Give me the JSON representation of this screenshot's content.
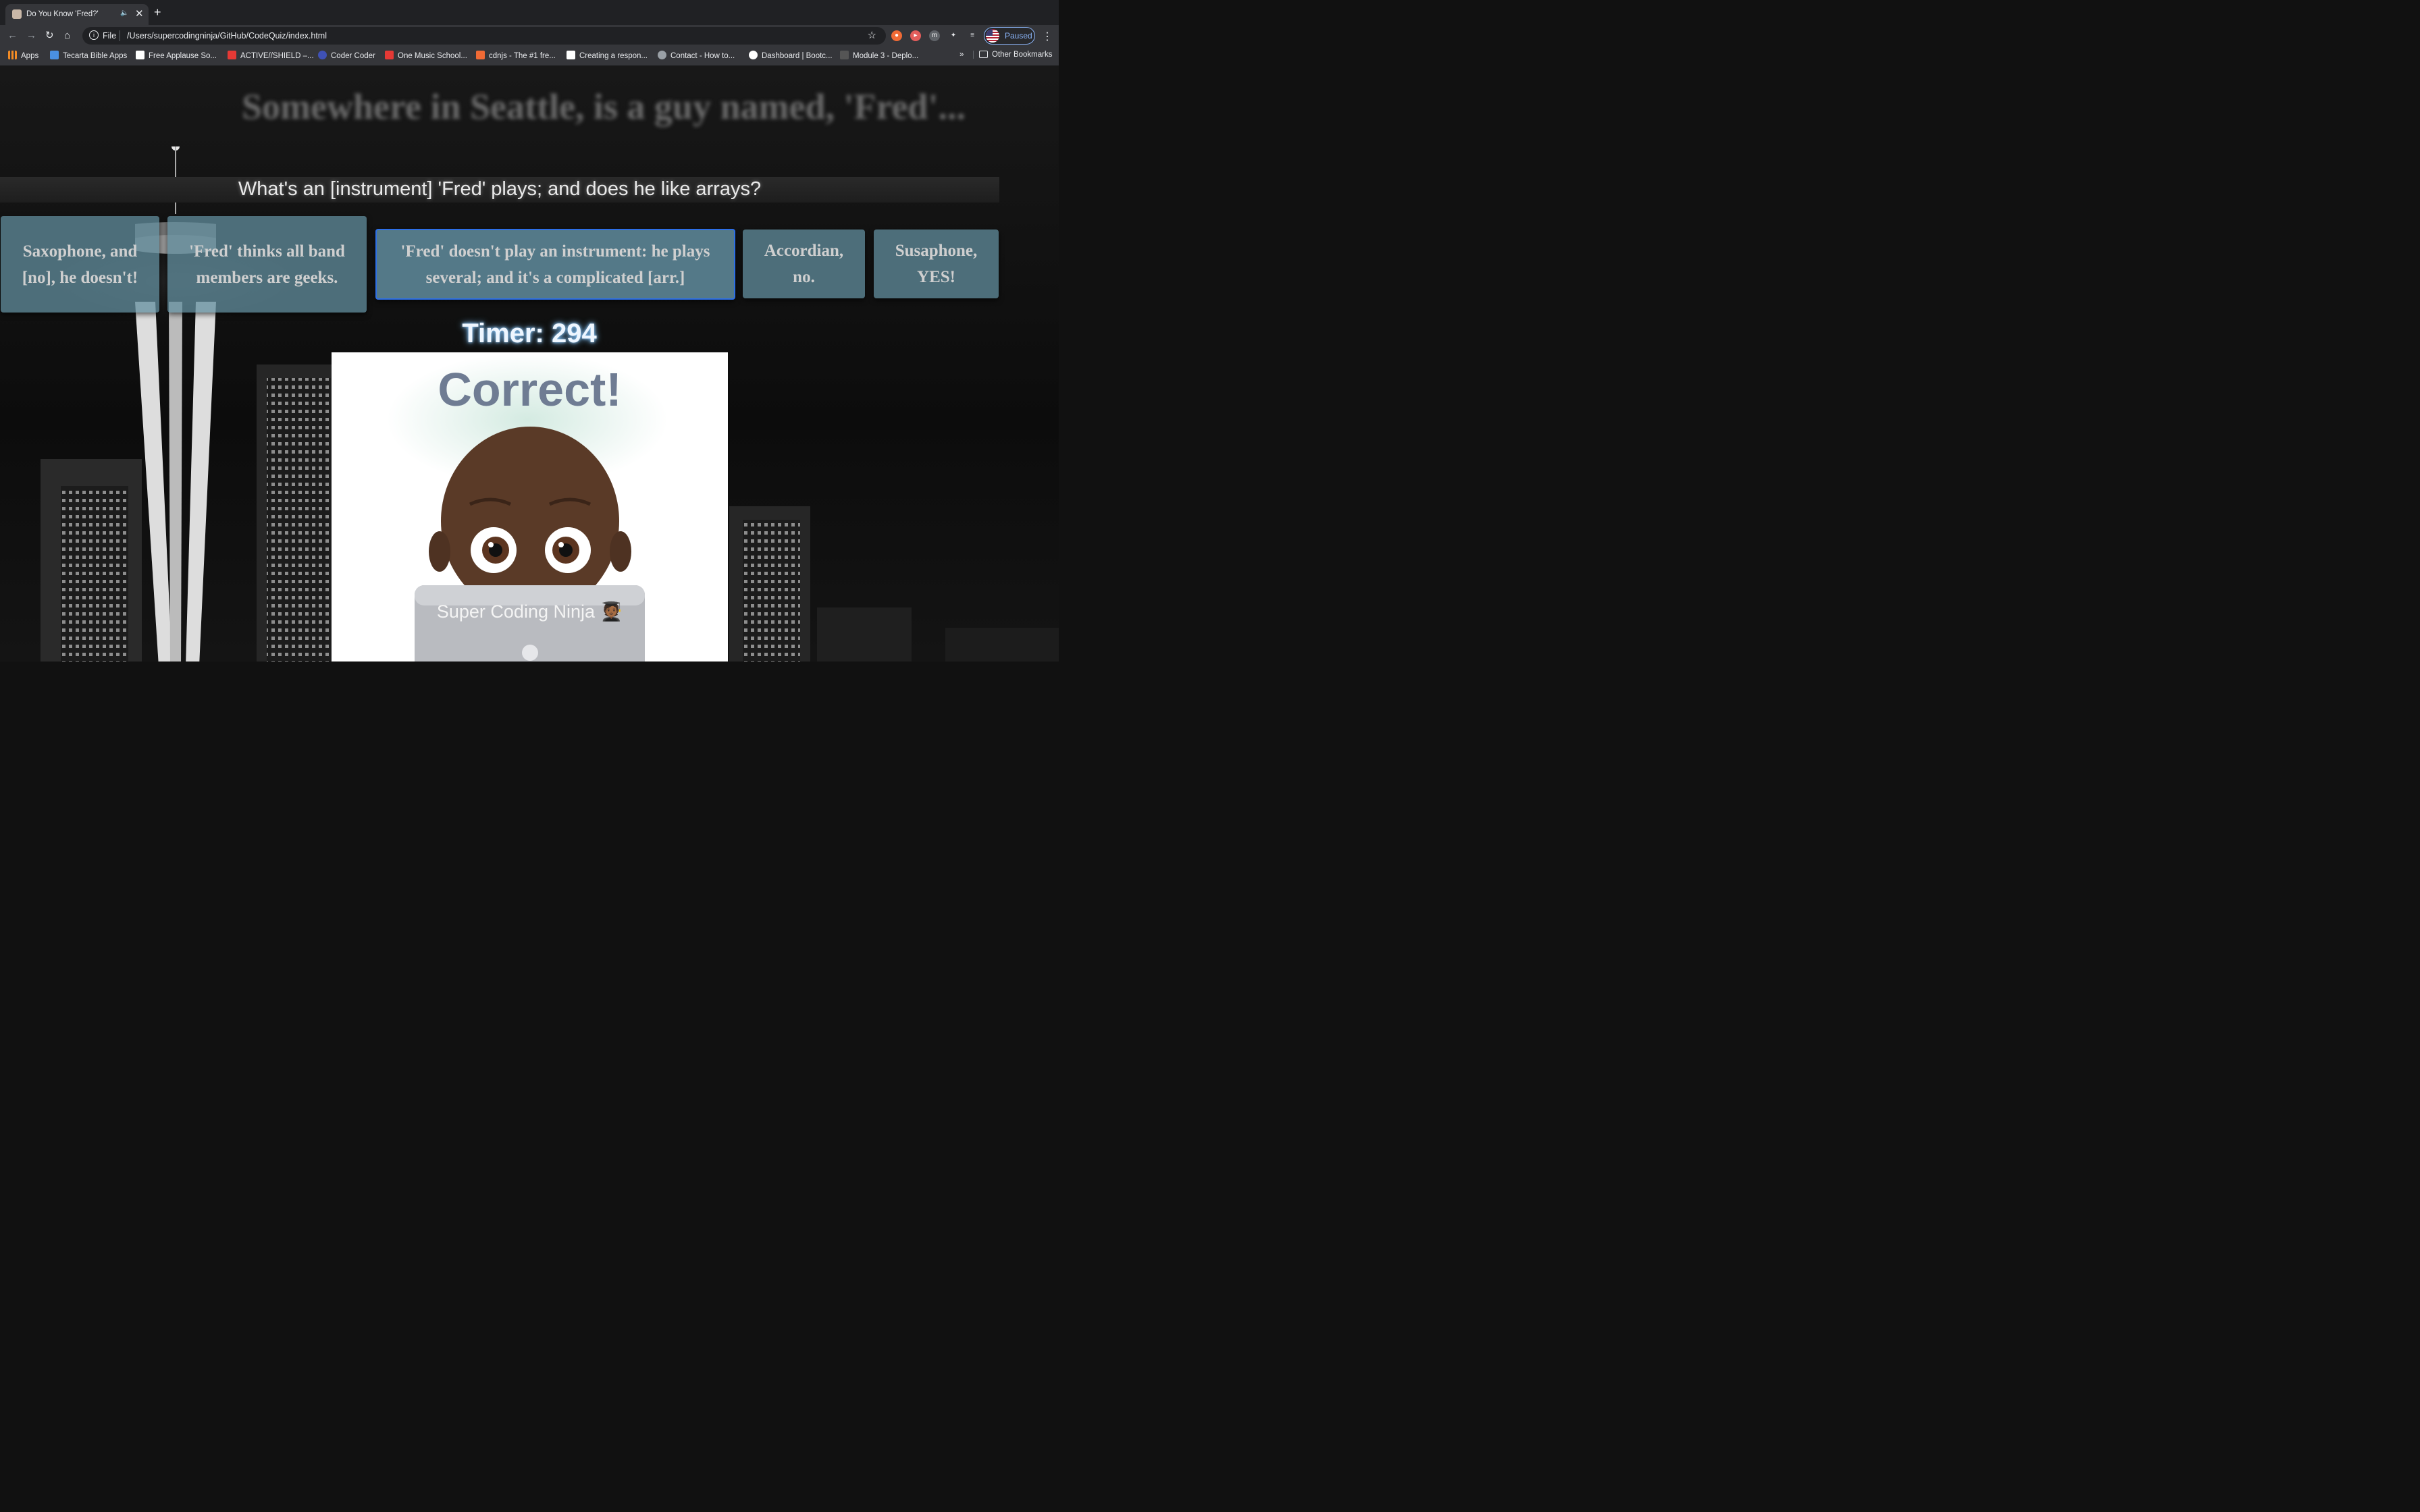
{
  "browser": {
    "tab": {
      "title": "Do You Know 'Fred?'"
    },
    "address": {
      "scheme": "File",
      "url": "/Users/supercodingninja/GitHub/CodeQuiz/index.html"
    },
    "profile_label": "Paused",
    "bookmarks": [
      {
        "label": "Apps",
        "color": "#f28b25"
      },
      {
        "label": "Tecarta Bible Apps",
        "color": "#4a90e2"
      },
      {
        "label": "Free Applause So...",
        "color": "#ffffff"
      },
      {
        "label": "ACTIVE//SHIELD –...",
        "color": "#e53935"
      },
      {
        "label": "Coder Coder",
        "color": "#3f51b5"
      },
      {
        "label": "One Music School...",
        "color": "#e53935"
      },
      {
        "label": "cdnjs - The #1 fre...",
        "color": "#f06a35"
      },
      {
        "label": "Creating a respon...",
        "color": "#ffffff"
      },
      {
        "label": "Contact - How to...",
        "color": "#9aa0a6"
      },
      {
        "label": "Dashboard | Bootc...",
        "color": "#ffffff"
      },
      {
        "label": "Module 3 - Deplo...",
        "color": "#555555"
      }
    ],
    "overflow": "»",
    "other_bookmarks": "Other Bookmarks"
  },
  "quiz": {
    "headline": "Somewhere in Seattle, is a guy named, 'Fred'...",
    "question": "What's an [instrument] 'Fred' plays; and does he like arrays?",
    "answers": [
      "Saxophone, and [no], he doesn't!",
      "'Fred' thinks all band members are geeks.",
      "'Fred' doesn't play an instrument: he plays several; and it's a complicated [arr.]",
      "Accordian, no.",
      "Susaphone, YES!"
    ],
    "timer": "Timer: 294",
    "result": "Correct!",
    "laptop_text": "Super Coding Ninja"
  },
  "colors": {
    "answer_bg": "#628e9e",
    "selected_border": "#2d6fe6",
    "timer_glow": "#7fc4ff",
    "result_text": "#6f7c93"
  }
}
